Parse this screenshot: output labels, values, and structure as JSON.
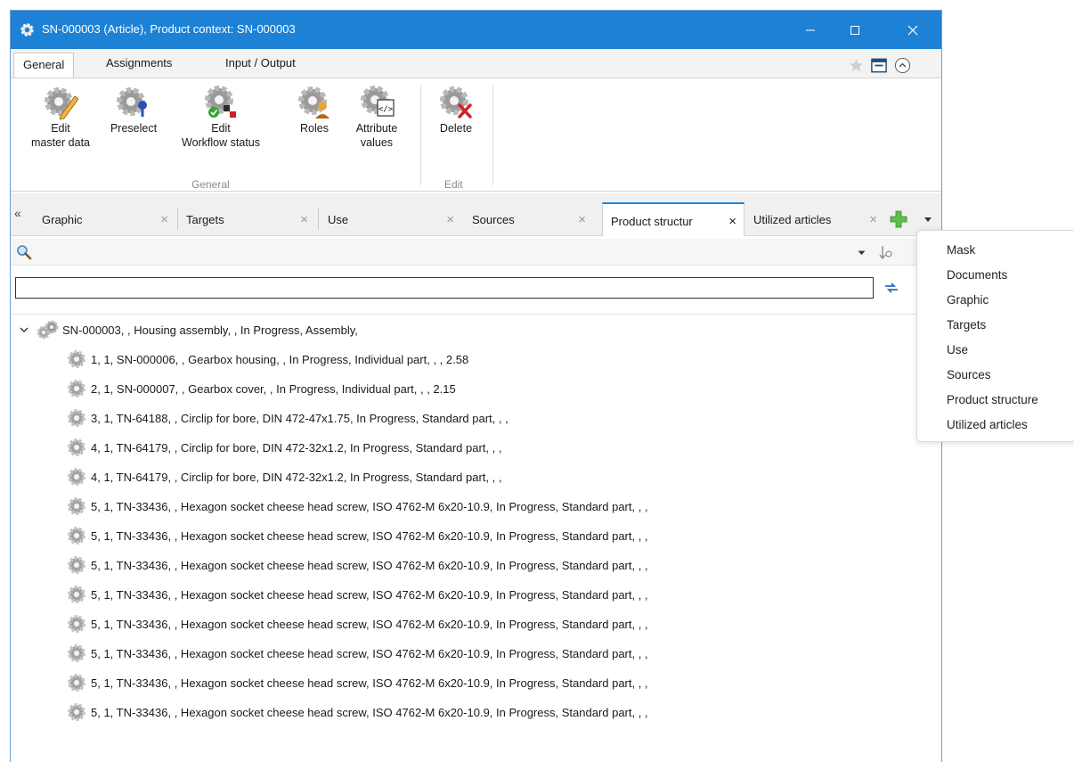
{
  "window": {
    "title": "SN-000003 (Article), Product context: SN-000003",
    "titlebar_color": "#1d82d6"
  },
  "ribbon_tabs": [
    "General",
    "Assignments",
    "Input / Output"
  ],
  "ribbon": {
    "buttons": [
      {
        "label": "Edit\nmaster data",
        "icon": "gear-pencil-icon"
      },
      {
        "label": "Preselect",
        "icon": "gear-pin-icon"
      },
      {
        "label": "Edit\nWorkflow status",
        "icon": "gear-workflow-icon"
      },
      {
        "label": "Roles",
        "icon": "gear-person-icon"
      },
      {
        "label": "Attribute\nvalues",
        "icon": "gear-code-icon"
      },
      {
        "label": "Delete",
        "icon": "gear-delete-icon"
      }
    ],
    "groups": [
      "General",
      "Edit"
    ]
  },
  "doc_tabs": [
    {
      "label": "Graphic",
      "active": false
    },
    {
      "label": "Targets",
      "active": false
    },
    {
      "label": "Use",
      "active": false
    },
    {
      "label": "Sources",
      "active": false
    },
    {
      "label": "Product structur",
      "active": true
    },
    {
      "label": "Utilized articles",
      "active": false
    }
  ],
  "filter": {
    "value": "",
    "placeholder": ""
  },
  "tree": {
    "root": "SN-000003, , Housing assembly, , In Progress, Assembly,",
    "children": [
      "1, 1, SN-000006, , Gearbox housing, , In Progress, Individual part, , , 2.58",
      "2, 1, SN-000007, , Gearbox cover, , In Progress, Individual part, , , 2.15",
      "3, 1, TN-64188, , Circlip for bore, DIN 472-47x1.75, In Progress, Standard part, , ,",
      "4, 1, TN-64179, , Circlip for bore, DIN 472-32x1.2, In Progress, Standard part, , ,",
      "4, 1, TN-64179, , Circlip for bore, DIN 472-32x1.2, In Progress, Standard part, , ,",
      "5, 1, TN-33436, , Hexagon socket cheese head screw, ISO 4762-M 6x20-10.9, In Progress, Standard part, , ,",
      "5, 1, TN-33436, , Hexagon socket cheese head screw, ISO 4762-M 6x20-10.9, In Progress, Standard part, , ,",
      "5, 1, TN-33436, , Hexagon socket cheese head screw, ISO 4762-M 6x20-10.9, In Progress, Standard part, , ,",
      "5, 1, TN-33436, , Hexagon socket cheese head screw, ISO 4762-M 6x20-10.9, In Progress, Standard part, , ,",
      "5, 1, TN-33436, , Hexagon socket cheese head screw, ISO 4762-M 6x20-10.9, In Progress, Standard part, , ,",
      "5, 1, TN-33436, , Hexagon socket cheese head screw, ISO 4762-M 6x20-10.9, In Progress, Standard part, , ,",
      "5, 1, TN-33436, , Hexagon socket cheese head screw, ISO 4762-M 6x20-10.9, In Progress, Standard part, , ,",
      "5, 1, TN-33436, , Hexagon socket cheese head screw, ISO 4762-M 6x20-10.9, In Progress, Standard part, , ,"
    ]
  },
  "dropdown_menu": [
    "Mask",
    "Documents",
    "Graphic",
    "Targets",
    "Use",
    "Sources",
    "Product structure",
    "Utilized articles"
  ]
}
